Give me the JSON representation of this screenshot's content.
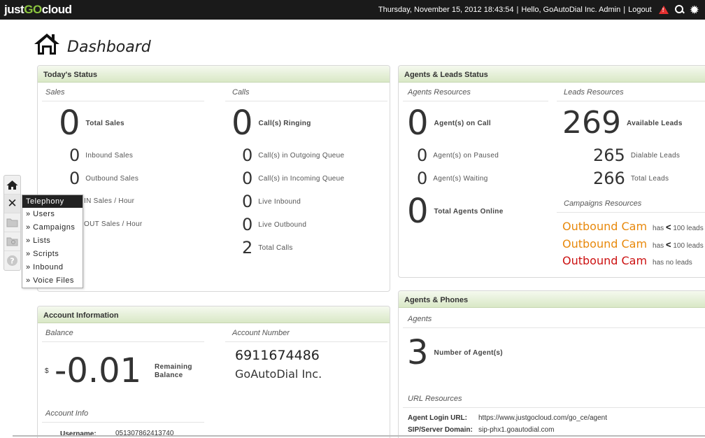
{
  "topbar": {
    "logo_pre": "just",
    "logo_go": "GO",
    "logo_post": "cloud",
    "datetime": "Thursday, November 15, 2012 18:43:54",
    "separator1": "|",
    "greeting": "Hello, GoAutoDial Inc. Admin",
    "separator2": "|",
    "logout": "Logout"
  },
  "page": {
    "title": "Dashboard"
  },
  "todays_status": {
    "header": "Today's Status",
    "sales_label": "Sales",
    "calls_label": "Calls",
    "total_sales": {
      "value": "0",
      "label": "Total Sales"
    },
    "inbound_sales": {
      "value": "0",
      "label": "Inbound Sales"
    },
    "outbound_sales": {
      "value": "0",
      "label": "Outbound Sales"
    },
    "in_sales_hour": {
      "label": "IN Sales / Hour"
    },
    "out_sales_hour": {
      "label": "OUT Sales / Hour"
    },
    "calls_ringing": {
      "value": "0",
      "label": "Call(s) Ringing"
    },
    "outgoing_queue": {
      "value": "0",
      "label": "Call(s) in Outgoing Queue"
    },
    "incoming_queue": {
      "value": "0",
      "label": "Call(s) in Incoming Queue"
    },
    "live_inbound": {
      "value": "0",
      "label": "Live Inbound"
    },
    "live_outbound": {
      "value": "0",
      "label": "Live Outbound"
    },
    "total_calls": {
      "value": "2",
      "label": "Total Calls"
    }
  },
  "agents_leads": {
    "header": "Agents & Leads Status",
    "agents_label": "Agents Resources",
    "leads_label": "Leads Resources",
    "on_call": {
      "value": "0",
      "label": "Agent(s) on Call"
    },
    "on_paused": {
      "value": "0",
      "label": "Agent(s) on Paused"
    },
    "waiting": {
      "value": "0",
      "label": "Agent(s) Waiting"
    },
    "total_online": {
      "value": "0",
      "label": "Total Agents Online"
    },
    "available_leads": {
      "value": "269",
      "label": "Available Leads"
    },
    "dialable_leads": {
      "value": "265",
      "label": "Dialable Leads"
    },
    "total_leads": {
      "value": "266",
      "label": "Total Leads"
    },
    "campaigns_label": "Campaigns Resources",
    "campaigns": [
      {
        "name": "Outbound Cam",
        "note_pre": "has",
        "note_sym": "<",
        "note_post": "100 leads",
        "color": "#e8890c"
      },
      {
        "name": "Outbound Cam",
        "note_pre": "has",
        "note_sym": "<",
        "note_post": "100 leads",
        "color": "#e8890c"
      },
      {
        "name": "Outbound Cam",
        "note_pre": "has no leads",
        "note_sym": "",
        "note_post": "",
        "color": "#cc1111"
      }
    ]
  },
  "account": {
    "header": "Account Information",
    "balance_label": "Balance",
    "currency": "$",
    "balance": "-0.01",
    "remaining_label_1": "Remaining",
    "remaining_label_2": "Balance",
    "account_number_label": "Account Number",
    "account_number": "6911674486",
    "company": "GoAutoDial Inc.",
    "info_label": "Account Info",
    "username_label": "Username:",
    "username": "051307862413740"
  },
  "agents_phones": {
    "header": "Agents & Phones",
    "agents_label": "Agents",
    "num_agents": {
      "value": "3",
      "label": "Number of Agent(s)"
    },
    "url_label": "URL Resources",
    "login_url_label": "Agent Login URL:",
    "login_url": "https://www.justgocloud.com/go_ce/agent",
    "sip_label": "SIP/Server Domain:",
    "sip": "sip-phx1.goautodial.com"
  },
  "submenu": {
    "header": "Telephony",
    "items": [
      "» Users",
      "» Campaigns",
      "» Lists",
      "» Scripts",
      "» Inbound",
      "» Voice Files"
    ]
  },
  "sidebar": {
    "icons": [
      "home-icon",
      "tools-icon",
      "folder-icon",
      "folder-search-icon",
      "help-icon"
    ]
  }
}
